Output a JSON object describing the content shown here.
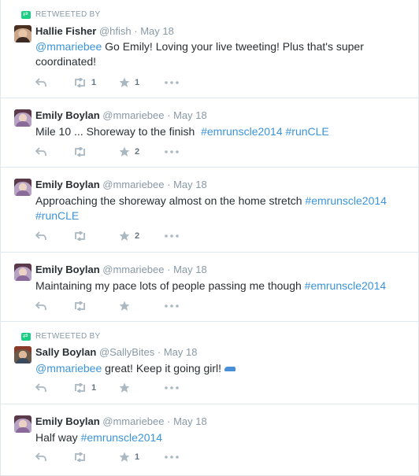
{
  "tweets": [
    {
      "retweeted_by": "RETWEETED BY",
      "fullname": "Hallie Fisher",
      "handle": "@hfish",
      "dot": "·",
      "time": "May 18",
      "text_parts": [
        {
          "type": "mention",
          "text": "@mmariebee"
        },
        {
          "type": "text",
          "text": " Go Emily! Loving your live tweeting! Plus that's super coordinated!"
        }
      ],
      "retweets": "1",
      "favorites": "1"
    },
    {
      "fullname": "Emily Boylan",
      "handle": "@mmariebee",
      "dot": "·",
      "time": "May 18",
      "text_parts": [
        {
          "type": "text",
          "text": "Mile 10 ... Shoreway to the finish  "
        },
        {
          "type": "tag",
          "text": "#emrunscle2014"
        },
        {
          "type": "text",
          "text": " "
        },
        {
          "type": "tag",
          "text": "#runCLE"
        }
      ],
      "retweets": "",
      "favorites": "2"
    },
    {
      "fullname": "Emily Boylan",
      "handle": "@mmariebee",
      "dot": "·",
      "time": "May 18",
      "text_parts": [
        {
          "type": "text",
          "text": "Approaching the shoreway almost on the home stretch "
        },
        {
          "type": "tag",
          "text": "#emrunscle2014"
        },
        {
          "type": "text",
          "text": " "
        },
        {
          "type": "tag",
          "text": "#runCLE"
        }
      ],
      "retweets": "",
      "favorites": "2"
    },
    {
      "fullname": "Emily Boylan",
      "handle": "@mmariebee",
      "dot": "·",
      "time": "May 18",
      "text_parts": [
        {
          "type": "text",
          "text": "Maintaining my pace lots of people passing me though "
        },
        {
          "type": "tag",
          "text": "#emrunscle2014"
        }
      ],
      "retweets": "",
      "favorites": ""
    },
    {
      "retweeted_by": "RETWEETED BY",
      "fullname": "Sally Boylan",
      "handle": "@SallyBites",
      "dot": "·",
      "time": "May 18",
      "text_parts": [
        {
          "type": "mention",
          "text": "@mmariebee"
        },
        {
          "type": "text",
          "text": " great! Keep it going girl!"
        }
      ],
      "retweets": "1",
      "favorites": ""
    },
    {
      "fullname": "Emily Boylan",
      "handle": "@mmariebee",
      "dot": "·",
      "time": "May 18",
      "text_parts": [
        {
          "type": "text",
          "text": "Half way "
        },
        {
          "type": "tag",
          "text": "#emrunscle2014"
        }
      ],
      "retweets": "",
      "favorites": "1"
    }
  ],
  "icons": {
    "reply": "reply-icon",
    "retweet": "retweet-icon",
    "favorite": "star-icon",
    "more": "more-icon",
    "retweet_context": "retweet-context-icon"
  },
  "colors": {
    "link": "#3b94d9",
    "muted": "#8899a6",
    "action": "#aab8c2",
    "retweet_green": "#19cf86",
    "border": "#e1e8ed"
  }
}
